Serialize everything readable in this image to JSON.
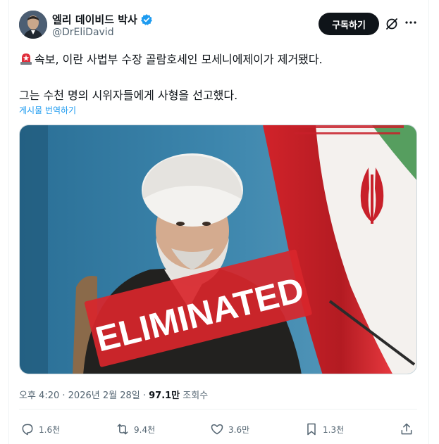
{
  "user": {
    "display_name": "엘리 데이비드 박사",
    "handle": "@DrEliDavid",
    "verified": true
  },
  "header": {
    "subscribe_label": "구독하기"
  },
  "post": {
    "line1": "속보, 이란 사법부 수장 골람호세인 모세니에제이가 제거됐다.",
    "line2": "그는 수천 명의 시위자들에게 사형을 선고했다.",
    "translate_label": "게시물 번역하기",
    "media_overlay_text": "ELIMINATED"
  },
  "meta": {
    "time": "오후 4:20",
    "date": "2026년 2월 28일",
    "views_count": "97.1만",
    "views_label": "조회수"
  },
  "actions": {
    "replies": "1.6천",
    "reposts": "9.4천",
    "likes": "3.6만",
    "bookmarks": "1.3천"
  },
  "colors": {
    "accent": "#1d9bf0",
    "text": "#0f1419",
    "muted": "#536471",
    "stamp_red": "#d8262b"
  },
  "icons": [
    "verified-badge-icon",
    "grok-icon",
    "more-icon",
    "siren-icon",
    "reply-icon",
    "repost-icon",
    "like-icon",
    "bookmark-icon",
    "share-icon"
  ]
}
